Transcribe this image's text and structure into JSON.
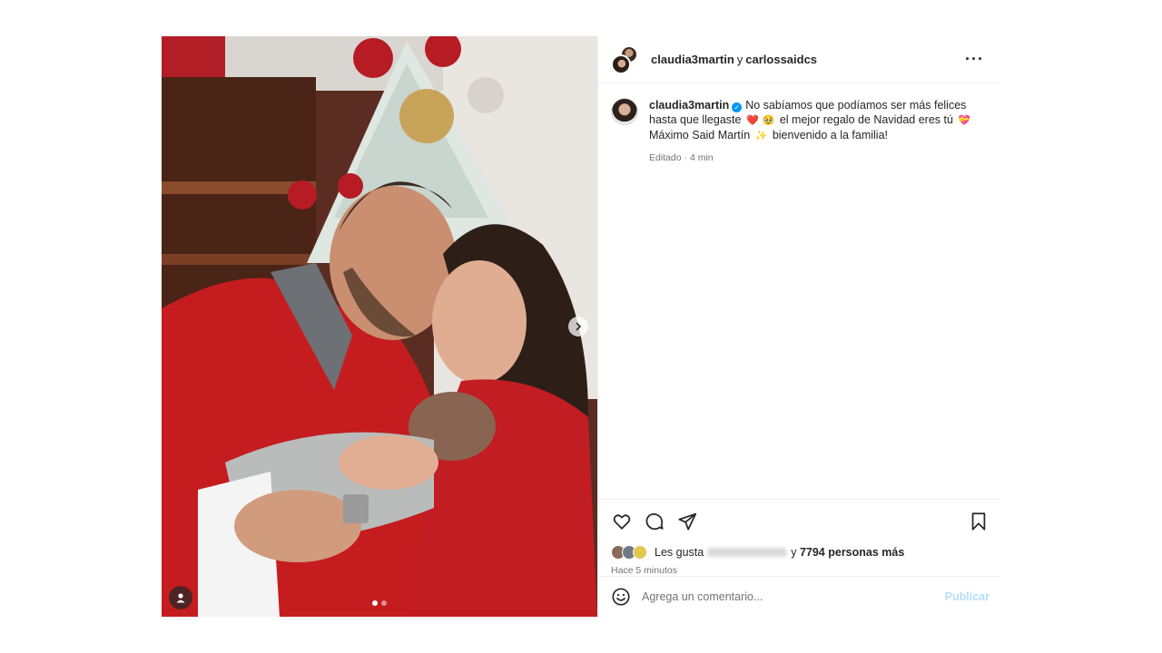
{
  "header": {
    "user1": "claudia3martin",
    "conjunction": "y",
    "user2": "carlossaidcs",
    "more_icon": "more-horizontal-icon"
  },
  "caption": {
    "username": "claudia3martin",
    "part1": "No sabíamos que podíamos ser más felices hasta que llegaste",
    "emoji1": "❤️",
    "emoji2": "🥹",
    "part2": "el mejor regalo de Navidad eres tú",
    "emoji3": "💝",
    "part3": "Máximo Said Martín",
    "emoji4": "✨",
    "part4": "bienvenido a la familia!",
    "meta": "Editado · 4 min"
  },
  "actions": {
    "like_icon": "heart-icon",
    "comment_icon": "comment-icon",
    "share_icon": "send-icon",
    "save_icon": "bookmark-icon"
  },
  "likes": {
    "prefix": "Les gusta",
    "joiner": "y",
    "count_text": "7794 personas más"
  },
  "time_ago": "Hace 5 minutos",
  "comment": {
    "placeholder": "Agrega un comentario...",
    "publish_label": "Publicar"
  },
  "carousel": {
    "current": 1,
    "total": 2
  },
  "colors": {
    "link_disabled": "#b2dffc",
    "verified": "#0095f6",
    "muted_text": "#737373"
  }
}
